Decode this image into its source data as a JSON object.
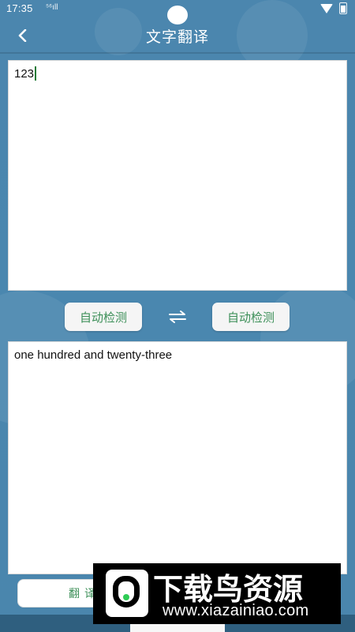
{
  "status_bar": {
    "time": "17:35",
    "signal_label": "⁵⁶ıll"
  },
  "app": {
    "title": "文字翻译",
    "back_icon": "chevron-left-icon"
  },
  "source": {
    "text": "123"
  },
  "languages": {
    "source_label": "自动检测",
    "target_label": "自动检测",
    "swap_icon": "swap-arrows-icon"
  },
  "result": {
    "text": "one hundred and twenty-three"
  },
  "actions": {
    "translate_label": "翻译"
  },
  "watermark": {
    "title": "下载鸟资源",
    "url": "www.xiazainiao.com"
  },
  "colors": {
    "background": "#4a86ad",
    "accent_text": "#3c8f58",
    "button_bg": "#f5f5f5"
  }
}
